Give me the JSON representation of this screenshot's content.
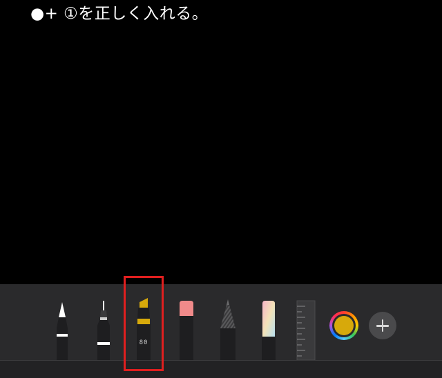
{
  "instruction": {
    "text": "●+ ①を正しく入れる。"
  },
  "toolbar": {
    "tools": [
      {
        "name": "pen",
        "icon": "pen-icon"
      },
      {
        "name": "fineliner",
        "icon": "fineliner-icon"
      },
      {
        "name": "marker",
        "icon": "marker-icon",
        "width_label": "80",
        "selected": true
      },
      {
        "name": "eraser",
        "icon": "eraser-icon"
      },
      {
        "name": "pencil",
        "icon": "pencil-icon"
      },
      {
        "name": "crayon",
        "icon": "crayon-icon"
      },
      {
        "name": "ruler",
        "icon": "ruler-icon"
      }
    ],
    "current_color": "#d7a90b",
    "color_picker_icon": "color-wheel-icon",
    "add_button_icon": "plus-icon"
  },
  "highlight": {
    "color": "#e01f1f"
  }
}
